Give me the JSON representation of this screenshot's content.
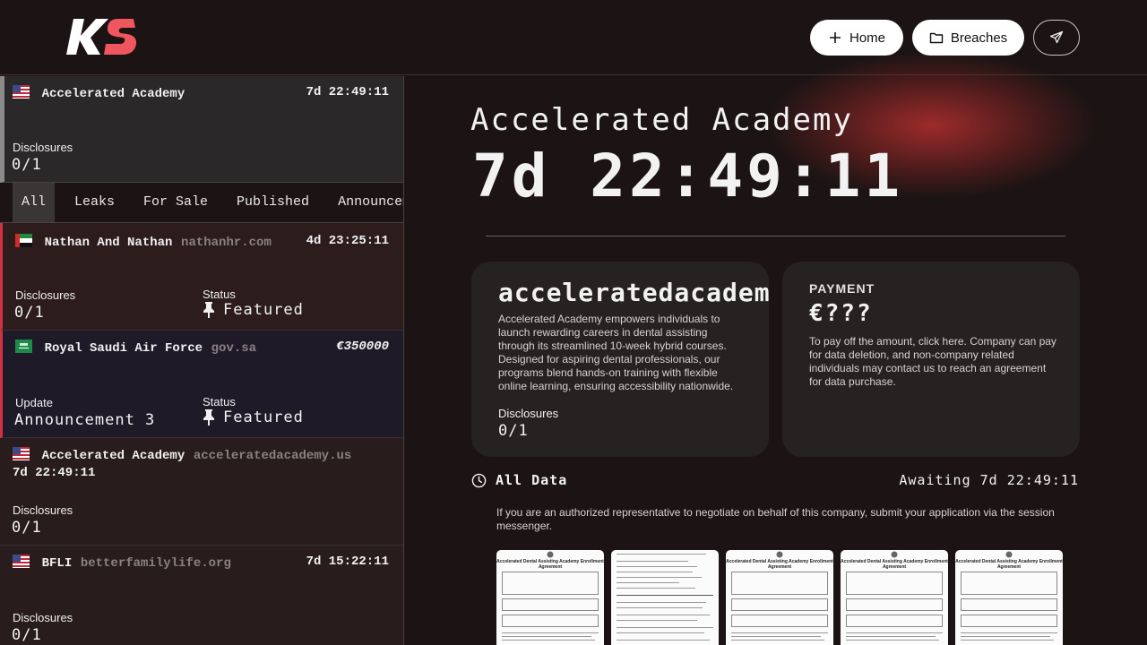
{
  "header": {
    "logo_text": "KS",
    "nav": {
      "home_label": "Home",
      "breaches_label": "Breaches"
    }
  },
  "sidebar": {
    "selected": {
      "title": "Accelerated Academy",
      "time": "7d 22:49:11",
      "disclosures_label": "Disclosures",
      "disclosures_value": "0/1"
    },
    "tabs": [
      "All",
      "Leaks",
      "For Sale",
      "Published",
      "Announcem"
    ],
    "items": [
      {
        "title": "Nathan And Nathan",
        "domain": "nathanhr.com",
        "right": "4d 23:25:11",
        "left_label": "Disclosures",
        "left_value": "0/1",
        "status_label": "Status",
        "status_value": "Featured"
      },
      {
        "title": "Royal Saudi Air Force",
        "domain": "gov.sa",
        "right": "€350000",
        "left_label": "Update",
        "left_value": "Announcement 3",
        "status_label": "Status",
        "status_value": "Featured"
      },
      {
        "title": "Accelerated Academy",
        "domain": "acceleratedacademy.us",
        "right": "7d 22:49:11",
        "left_label": "Disclosures",
        "left_value": "0/1"
      },
      {
        "title": "BFLI",
        "domain": "betterfamilylife.org",
        "right": "7d 15:22:11",
        "left_label": "Disclosures",
        "left_value": "0/1"
      }
    ]
  },
  "main": {
    "title": "Accelerated Academy",
    "timer": "7d 22:49:11",
    "company_panel": {
      "name": "acceleratedacademy",
      "description": "Accelerated Academy empowers individuals to launch rewarding careers in dental assisting through its streamlined 10-week hybrid courses. Designed for aspiring dental professionals, our programs blend hands-on training with flexible online learning, ensuring accessibility nationwide.",
      "disclosures_label": "Disclosures",
      "disclosures_value": "0/1"
    },
    "payment_panel": {
      "label": "PAYMENT",
      "amount": "€???",
      "description": "To pay off the amount, click here. Company can pay for data deletion, and non-company related individuals may contact us to reach an agreement for data purchase."
    },
    "all_data": {
      "label": "All Data",
      "awaiting": "Awaiting 7d 22:49:11",
      "notice": "If you are an authorized representative to negotiate on behalf of this company, submit your application via the session messenger."
    },
    "thumbnails": [
      {
        "heading": "Accelerated Dental Assisting Academy Enrollment Agreement"
      },
      {
        "heading": ""
      },
      {
        "heading": "Accelerated Dental Assisting Academy Enrollment Agreement"
      },
      {
        "heading": "Accelerated Dental Assisting Academy Enrollment Agreement"
      },
      {
        "heading": "Accelerated Dental Assisting Academy Enrollment Agreement"
      }
    ]
  },
  "colors": {
    "background": "#1c1414",
    "accent_red": "#d13045",
    "panel": "#272222"
  }
}
